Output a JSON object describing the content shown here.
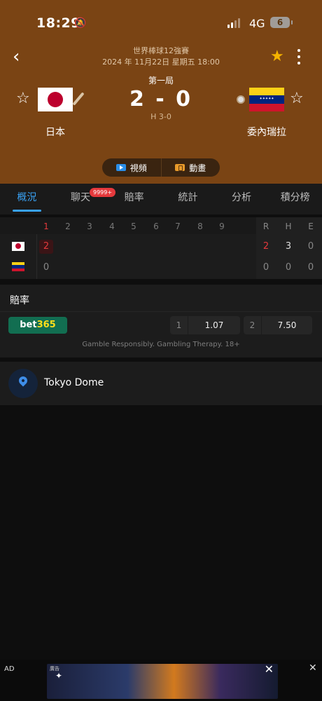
{
  "status": {
    "time": "18:29",
    "network": "4G",
    "battery": "6"
  },
  "header": {
    "league": "世界棒球12強賽",
    "datetime": "2024 年 11月22日 星期五 18:00",
    "inning": "第一局",
    "score": "2 - 0",
    "hits": "H 3-0",
    "home_team": "日本",
    "away_team": "委內瑞拉"
  },
  "media": {
    "video_label": "視頻",
    "animation_label": "動畫"
  },
  "tabs": [
    {
      "label": "概況",
      "active": true
    },
    {
      "label": "聊天",
      "badge": "9999+"
    },
    {
      "label": "賠率"
    },
    {
      "label": "統計"
    },
    {
      "label": "分析"
    },
    {
      "label": "積分榜"
    }
  ],
  "linescore": {
    "innings": [
      "1",
      "2",
      "3",
      "4",
      "5",
      "6",
      "7",
      "8",
      "9"
    ],
    "totals_labels": [
      "R",
      "H",
      "E"
    ],
    "rows": [
      {
        "team": "japan",
        "innings": [
          "2"
        ],
        "R": "2",
        "H": "3",
        "E": "0"
      },
      {
        "team": "venezuela",
        "innings": [
          "0"
        ],
        "R": "0",
        "H": "0",
        "E": "0"
      }
    ]
  },
  "odds": {
    "title": "賠率",
    "bookmaker": {
      "left": "bet",
      "right": "365"
    },
    "options": [
      {
        "index": "1",
        "value": "1.07"
      },
      {
        "index": "2",
        "value": "7.50"
      }
    ],
    "disclaimer": "Gamble Responsibly. Gambling Therapy. 18+"
  },
  "venue": {
    "name": "Tokyo Dome"
  },
  "ad": {
    "label": "AD",
    "tag": "廣告",
    "close": "✕"
  },
  "colors": {
    "header_bg": "#7a4414",
    "accent": "#39a2f5",
    "live_red": "#e5393c",
    "favorite": "#f5b300",
    "bet365_green": "#126e51"
  }
}
